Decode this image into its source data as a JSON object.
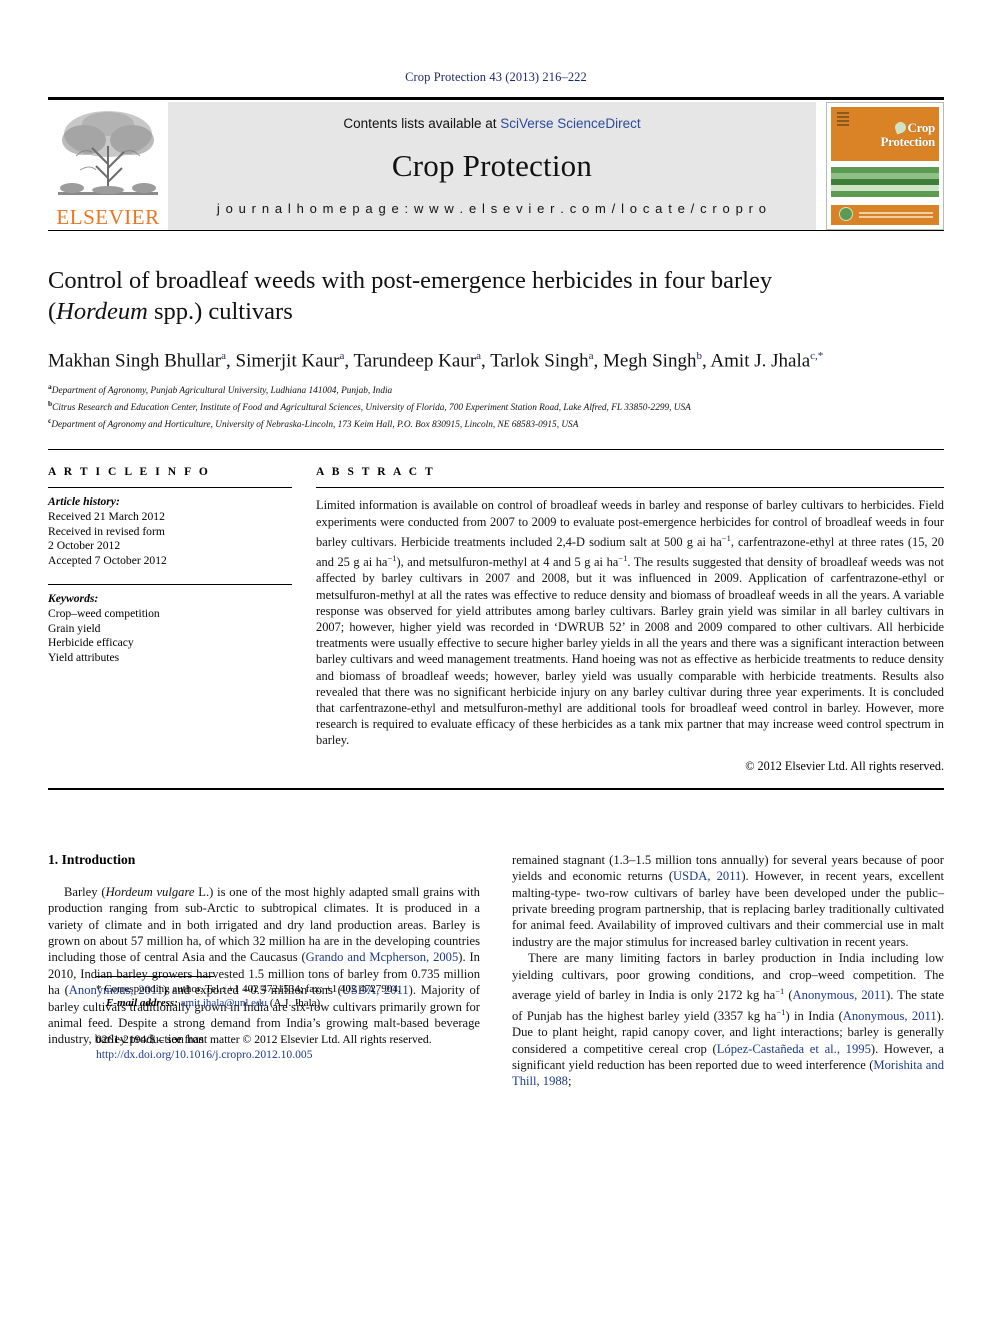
{
  "running_head": "Crop Protection 43 (2013) 216–222",
  "masthead": {
    "publisher_name": "ELSEVIER",
    "contents_prefix": "Contents lists available at ",
    "contents_link": "SciVerse ScienceDirect",
    "journal_name": "Crop Protection",
    "homepage_label": "j o u r n a l   h o m e p a g e :   w w w . e l s e v i e r . c o m / l o c a t e / c r o p r o",
    "cover_title_line1": "Crop",
    "cover_title_line2": "Protection",
    "cover_stripe_colors": [
      "#ffffff",
      "#5e9b52",
      "#8fc087",
      "#3f7f3a",
      "#cfe3c6",
      "#5e9b52",
      "#ffffff",
      "#8fc087"
    ]
  },
  "article": {
    "title_line1": "Control of broadleaf weeds with post-emergence herbicides in four barley",
    "title_italic": "Hordeum",
    "title_line2_pre": "(",
    "title_line2_post": " spp.) cultivars",
    "authors": [
      {
        "name": "Makhan Singh Bhullar",
        "sup": "a"
      },
      {
        "name": "Simerjit Kaur",
        "sup": "a"
      },
      {
        "name": "Tarundeep Kaur",
        "sup": "a"
      },
      {
        "name": "Tarlok Singh",
        "sup": "a"
      },
      {
        "name": "Megh Singh",
        "sup": "b"
      },
      {
        "name": "Amit J. Jhala",
        "sup": "c,*"
      }
    ],
    "affiliations": [
      {
        "marker": "a",
        "text": "Department of Agronomy, Punjab Agricultural University, Ludhiana 141004, Punjab, India"
      },
      {
        "marker": "b",
        "text": "Citrus Research and Education Center, Institute of Food and Agricultural Sciences, University of Florida, 700 Experiment Station Road, Lake Alfred, FL 33850-2299, USA"
      },
      {
        "marker": "c",
        "text": "Department of Agronomy and Horticulture, University of Nebraska-Lincoln, 173 Keim Hall, P.O. Box 830915, Lincoln, NE 68583-0915, USA"
      }
    ]
  },
  "article_info": {
    "heading": "A R T I C L E   I N F O",
    "history_label": "Article history:",
    "history_lines": [
      "Received 21 March 2012",
      "Received in revised form",
      "2 October 2012",
      "Accepted 7 October 2012"
    ],
    "keywords_label": "Keywords:",
    "keywords": [
      "Crop–weed competition",
      "Grain yield",
      "Herbicide efficacy",
      "Yield attributes"
    ]
  },
  "abstract": {
    "heading": "A B S T R A C T",
    "para_1": "Limited information is available on control of broadleaf weeds in barley and response of barley cultivars to herbicides. Field experiments were conducted from 2007 to 2009 to evaluate post-emergence herbicides for control of broadleaf weeds in four barley cultivars. Herbicide treatments included 2,4-D sodium salt at 500 g ai ha",
    "sup_1": "−1",
    "para_2": ", carfentrazone-ethyl at three rates (15, 20 and 25 g ai ha",
    "sup_2": "−1",
    "para_3": "), and metsulfuron-methyl at 4 and 5 g ai ha",
    "sup_3": "−1",
    "para_4": ". The results suggested that density of broadleaf weeds was not affected by barley cultivars in 2007 and 2008, but it was influenced in 2009. Application of carfentrazone-ethyl or metsulfuron-methyl at all the rates was effective to reduce density and biomass of broadleaf weeds in all the years. A variable response was observed for yield attributes among barley cultivars. Barley grain yield was similar in all barley cultivars in 2007; however, higher yield was recorded in ‘DWRUB 52’ in 2008 and 2009 compared to other cultivars. All herbicide treatments were usually effective to secure higher barley yields in all the years and there was a significant interaction between barley cultivars and weed management treatments. Hand hoeing was not as effective as herbicide treatments to reduce density and biomass of broadleaf weeds; however, barley yield was usually comparable with herbicide treatments. Results also revealed that there was no significant herbicide injury on any barley cultivar during three year experiments. It is concluded that carfentrazone-ethyl and metsulfuron-methyl are additional tools for broadleaf weed control in barley. However, more research is required to evaluate efficacy of these herbicides as a tank mix partner that may increase weed control spectrum in barley.",
    "copyright": "© 2012 Elsevier Ltd. All rights reserved."
  },
  "introduction": {
    "heading": "1. Introduction",
    "left_para_pre": "Barley (",
    "left_para_ital": "Hordeum vulgare",
    "left_para_a": " L.) is one of the most highly adapted small grains with production ranging from sub-Arctic to subtropical climates. It is produced in a variety of climate and in both irrigated and dry land production areas. Barley is grown on about 57 million ha, of which 32 million ha are in the developing countries including those of central Asia and the Caucasus (",
    "ref_1": "Grando and Mcpherson, 2005",
    "left_para_b": "). In 2010, Indian barley growers harvested 1.5 million tons of barley from 0.735 million ha (",
    "ref_2": "Anonymous, 2011",
    "left_para_c": ") and exported ~0.5 million tons (",
    "ref_3": "USDA, 2011",
    "left_para_d": "). Majority of barley cultivars traditionally grown in India are six-row cultivars primarily grown for animal feed. Despite a strong demand from India’s growing malt-based beverage industry, barley production has",
    "right_para_a": "remained stagnant (1.3–1.5 million tons annually) for several years because of poor yields and economic returns (",
    "ref_4": "USDA, 2011",
    "right_para_b": "). However, in recent years, excellent malting-type- two-row cultivars of barley have been developed under the public–private breeding program partnership, that is replacing barley traditionally cultivated for animal feed. Availability of improved cultivars and their commercial use in malt industry are the major stimulus for increased barley cultivation in recent years.",
    "right_para2_a": "There are many limiting factors in barley production in India including low yielding cultivars, poor growing conditions, and crop–weed competition. The average yield of barley in India is only 2172 kg ha",
    "sup_a": "−1",
    "right_para2_b": " (",
    "ref_5": "Anonymous, 2011",
    "right_para2_c": "). The state of Punjab has the highest barley yield (3357 kg ha",
    "sup_b": "−1",
    "right_para2_d": ") in India (",
    "ref_6": "Anonymous, 2011",
    "right_para2_e": "). Due to plant height, rapid canopy cover, and light interactions; barley is generally considered a competitive cereal crop (",
    "ref_7": "López-Castañeda et al., 1995",
    "right_para2_f": "). However, a significant yield reduction has been reported due to weed interference (",
    "ref_8": "Morishita and Thill, 1988",
    "right_para2_g": ";"
  },
  "footnote": {
    "corresponding": "* Corresponding author. Tel.: +1 402 4721534; fax: +1 402 4727904.",
    "email_label": "E-mail address:",
    "email": "amit.jhala@unl.edu",
    "email_suffix": " (A.J. Jhala).",
    "frontmatter": "0261-2194/$ – see front matter © 2012 Elsevier Ltd. All rights reserved.",
    "doi": "http://dx.doi.org/10.1016/j.cropro.2012.10.005"
  }
}
